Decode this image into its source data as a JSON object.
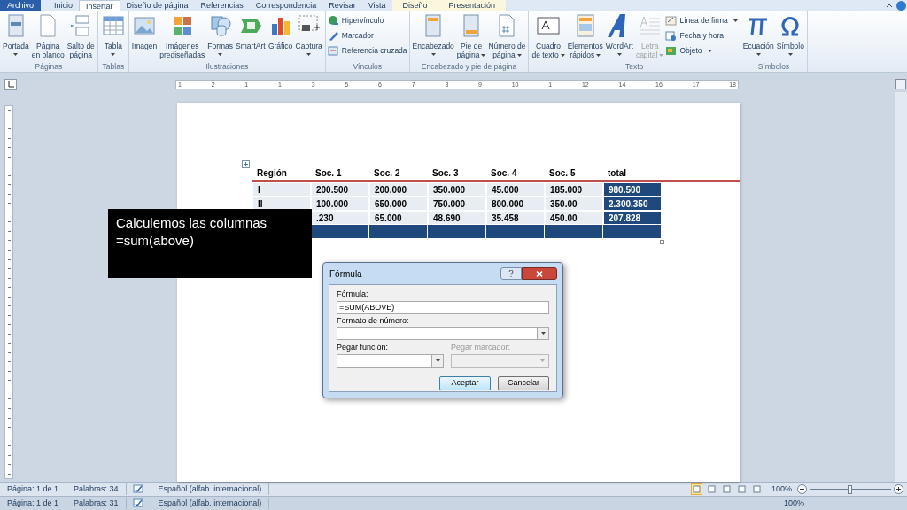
{
  "tabs": [
    {
      "label": "Archivo",
      "kind": "file",
      "selected": false
    },
    {
      "label": "Inicio",
      "kind": "normal",
      "selected": false
    },
    {
      "label": "Insertar",
      "kind": "normal",
      "selected": true
    },
    {
      "label": "Diseño de página",
      "kind": "normal",
      "selected": false
    },
    {
      "label": "Referencias",
      "kind": "normal",
      "selected": false
    },
    {
      "label": "Correspondencia",
      "kind": "normal",
      "selected": false
    },
    {
      "label": "Revisar",
      "kind": "normal",
      "selected": false
    },
    {
      "label": "Vista",
      "kind": "normal",
      "selected": false
    },
    {
      "label": "Diseño",
      "kind": "context",
      "selected": false
    },
    {
      "label": "Presentación",
      "kind": "context",
      "selected": false
    }
  ],
  "ribbon_groups": [
    {
      "label": "Páginas",
      "items": [
        {
          "kind": "large",
          "lines": [
            "Portada"
          ],
          "dropdown": true,
          "disabled": false
        },
        {
          "kind": "large",
          "lines": [
            "Página",
            "en blanco"
          ],
          "dropdown": false,
          "disabled": false
        },
        {
          "kind": "large",
          "lines": [
            "Salto de",
            "página"
          ],
          "dropdown": false,
          "disabled": false
        }
      ]
    },
    {
      "label": "Tablas",
      "items": [
        {
          "kind": "large",
          "lines": [
            "Tabla"
          ],
          "dropdown": true,
          "disabled": false
        }
      ]
    },
    {
      "label": "Ilustraciones",
      "items": [
        {
          "kind": "large",
          "lines": [
            "Imagen"
          ],
          "dropdown": false,
          "disabled": false
        },
        {
          "kind": "large",
          "lines": [
            "Imágenes",
            "prediseñadas"
          ],
          "dropdown": false,
          "disabled": false
        },
        {
          "kind": "large",
          "lines": [
            "Formas"
          ],
          "dropdown": true,
          "disabled": false
        },
        {
          "kind": "large",
          "lines": [
            "SmartArt"
          ],
          "dropdown": false,
          "disabled": false
        },
        {
          "kind": "large",
          "lines": [
            "Gráfico"
          ],
          "dropdown": false,
          "disabled": false
        },
        {
          "kind": "large",
          "lines": [
            "Captura"
          ],
          "dropdown": true,
          "disabled": false
        }
      ]
    },
    {
      "label": "Vínculos",
      "items": [
        {
          "kind": "small",
          "lines": [
            "Hipervínculo"
          ],
          "dropdown": false,
          "disabled": false
        },
        {
          "kind": "small",
          "lines": [
            "Marcador"
          ],
          "dropdown": false,
          "disabled": false
        },
        {
          "kind": "small",
          "lines": [
            "Referencia cruzada"
          ],
          "dropdown": false,
          "disabled": false
        }
      ]
    },
    {
      "label": "Encabezado y pie de página",
      "items": [
        {
          "kind": "large",
          "lines": [
            "Encabezado"
          ],
          "dropdown": true,
          "disabled": false
        },
        {
          "kind": "large",
          "lines": [
            "Pie de",
            "página"
          ],
          "dropdown": true,
          "disabled": false
        },
        {
          "kind": "large",
          "lines": [
            "Número de",
            "página"
          ],
          "dropdown": true,
          "disabled": false
        }
      ]
    },
    {
      "label": "Texto",
      "items": [
        {
          "kind": "large",
          "lines": [
            "Cuadro",
            "de texto"
          ],
          "dropdown": true,
          "disabled": false
        },
        {
          "kind": "large",
          "lines": [
            "Elementos",
            "rápidos"
          ],
          "dropdown": true,
          "disabled": false
        },
        {
          "kind": "large",
          "lines": [
            "WordArt"
          ],
          "dropdown": true,
          "disabled": false
        },
        {
          "kind": "large",
          "lines": [
            "Letra",
            "capital"
          ],
          "dropdown": true,
          "disabled": true
        },
        {
          "kind": "small",
          "lines": [
            "Línea de firma"
          ],
          "dropdown": true,
          "disabled": false
        },
        {
          "kind": "small",
          "lines": [
            "Fecha y hora"
          ],
          "dropdown": false,
          "disabled": false
        },
        {
          "kind": "small",
          "lines": [
            "Objeto"
          ],
          "dropdown": true,
          "disabled": false
        }
      ]
    },
    {
      "label": "Símbolos",
      "items": [
        {
          "kind": "large",
          "lines": [
            "Ecuación"
          ],
          "dropdown": true,
          "disabled": false
        },
        {
          "kind": "large",
          "lines": [
            "Símbolo"
          ],
          "dropdown": true,
          "disabled": false
        }
      ]
    }
  ],
  "ruler_numbers": [
    "1",
    "2",
    "1",
    "1",
    "3",
    "5",
    "6",
    "7",
    "8",
    "9",
    "10",
    "1",
    "12",
    "14",
    "16",
    "17",
    "18"
  ],
  "table": {
    "columns": [
      "Región",
      "Soc. 1",
      "Soc. 2",
      "Soc. 3",
      "Soc. 4",
      "Soc. 5",
      "total"
    ],
    "rows": [
      {
        "cells": [
          "I",
          "200.500",
          "200.000",
          "350.000",
          "45.000",
          "185.000",
          "980.500"
        ]
      },
      {
        "cells": [
          "II",
          "100.000",
          "650.000",
          "750.000",
          "800.000",
          "350.00",
          "2.300.350"
        ]
      },
      {
        "cells": [
          null,
          ".230",
          "65.000",
          "48.690",
          "35.458",
          "450.00",
          "207.828"
        ]
      }
    ]
  },
  "callout": {
    "lines": [
      "Calculemos las columnas",
      "=sum(above)"
    ]
  },
  "dialog": {
    "title": "Fórmula",
    "formula_label": "Fórmula:",
    "formula_value": "=SUM(ABOVE)",
    "format_label": "Formato de número:",
    "function_label": "Pegar función:",
    "bookmark_label": "Pegar marcador:",
    "bookmark_disabled": true,
    "ok": "Aceptar",
    "cancel": "Cancelar"
  },
  "status_bar": {
    "page": "Página: 1 de 1",
    "words": "Palabras: 34",
    "language": "Español (alfab. internacional)",
    "zoom": "100%",
    "zoom_slider": {
      "level": 0.5
    },
    "views": [
      {
        "selected": true
      },
      {
        "selected": false
      },
      {
        "selected": false
      },
      {
        "selected": false
      },
      {
        "selected": false
      }
    ]
  },
  "status_bar_echo": {
    "page": "Página: 1 de 1",
    "words": "Palabras: 31",
    "language": "Español (alfab. internacional)",
    "zoom": "100%"
  }
}
